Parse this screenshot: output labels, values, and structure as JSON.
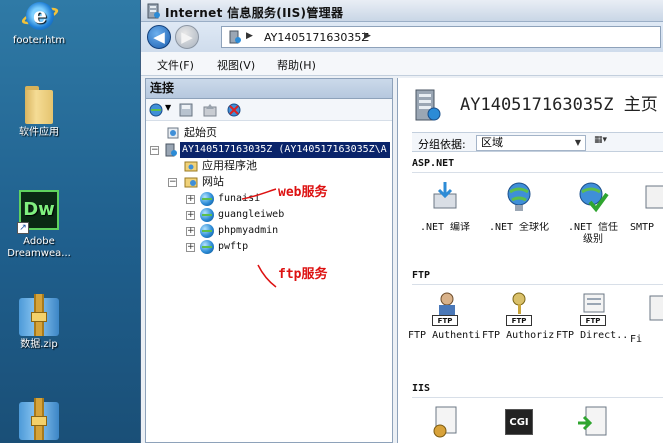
{
  "desktop": {
    "icons": [
      {
        "label": "footer.htm"
      },
      {
        "label": "软件应用"
      },
      {
        "label": "Adobe Dreamwea..."
      },
      {
        "label": "数据.zip"
      }
    ]
  },
  "window": {
    "title": "Internet 信息服务(IIS)管理器",
    "address": "AY140517163035Z",
    "menu": [
      "文件(F)",
      "视图(V)",
      "帮助(H)"
    ]
  },
  "connections": {
    "header": "连接",
    "tree": {
      "start_page": "起始页",
      "server": "AY140517163035Z (AY140517163035Z\\A",
      "app_pools": "应用程序池",
      "sites": "网站",
      "site_list": [
        "funaisi",
        "guangleiweb",
        "phpmyadmin",
        "pwftp"
      ]
    },
    "annotations": {
      "web": "web服务",
      "ftp": "ftp服务"
    }
  },
  "content": {
    "title": "AY140517163035Z 主页",
    "group_by_label": "分组依据:",
    "group_by_value": "区域",
    "sections": {
      "aspnet": "ASP.NET",
      "ftp": "FTP",
      "iis": "IIS"
    },
    "aspnet_features": [
      {
        "label": ".NET 编译"
      },
      {
        "label": ".NET 全球化"
      },
      {
        "label": ".NET 信任级别"
      },
      {
        "label": "SMTP"
      }
    ],
    "ftp_features": [
      {
        "label": "FTP Authenti..."
      },
      {
        "label": "FTP Authoriz..."
      },
      {
        "label": "FTP Direct..."
      },
      {
        "label": "Fi"
      }
    ],
    "iis_features": [
      {
        "label": ""
      },
      {
        "label": "CGI"
      },
      {
        "label": ""
      }
    ]
  },
  "colors": {
    "selection": "#0a246a",
    "annotation": "#dd1111"
  }
}
